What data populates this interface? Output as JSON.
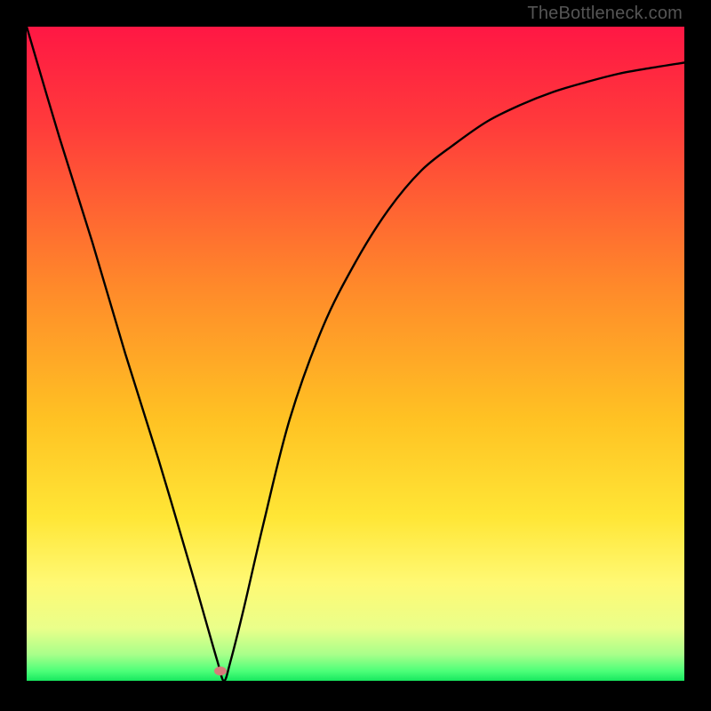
{
  "attribution": "TheBottleneck.com",
  "chart_data": {
    "type": "line",
    "title": "",
    "xlabel": "",
    "ylabel": "",
    "xlim": [
      0,
      100
    ],
    "ylim": [
      0,
      100
    ],
    "gradient_stops": [
      {
        "offset": 0,
        "color": "#ff1744"
      },
      {
        "offset": 0.15,
        "color": "#ff3b3b"
      },
      {
        "offset": 0.4,
        "color": "#ff8a2a"
      },
      {
        "offset": 0.6,
        "color": "#ffc223"
      },
      {
        "offset": 0.75,
        "color": "#ffe636"
      },
      {
        "offset": 0.85,
        "color": "#fff974"
      },
      {
        "offset": 0.92,
        "color": "#eaff8a"
      },
      {
        "offset": 0.96,
        "color": "#a8ff8a"
      },
      {
        "offset": 0.985,
        "color": "#4dff79"
      },
      {
        "offset": 1.0,
        "color": "#18e85f"
      }
    ],
    "series": [
      {
        "name": "bottleneck-curve",
        "x": [
          0.0,
          5,
          10,
          15,
          20,
          25,
          27,
          29,
          30,
          31,
          33,
          36,
          40,
          45,
          50,
          55,
          60,
          65,
          70,
          75,
          80,
          85,
          90,
          95,
          100
        ],
        "y": [
          100,
          83,
          67,
          50,
          34,
          17,
          10,
          3,
          0,
          3,
          11,
          24,
          40,
          54,
          64,
          72,
          78,
          82,
          85.5,
          88,
          90,
          91.5,
          92.8,
          93.7,
          94.5
        ]
      }
    ],
    "marker": {
      "x": 29.5,
      "y": 1.5,
      "color": "#d87a7a"
    }
  }
}
